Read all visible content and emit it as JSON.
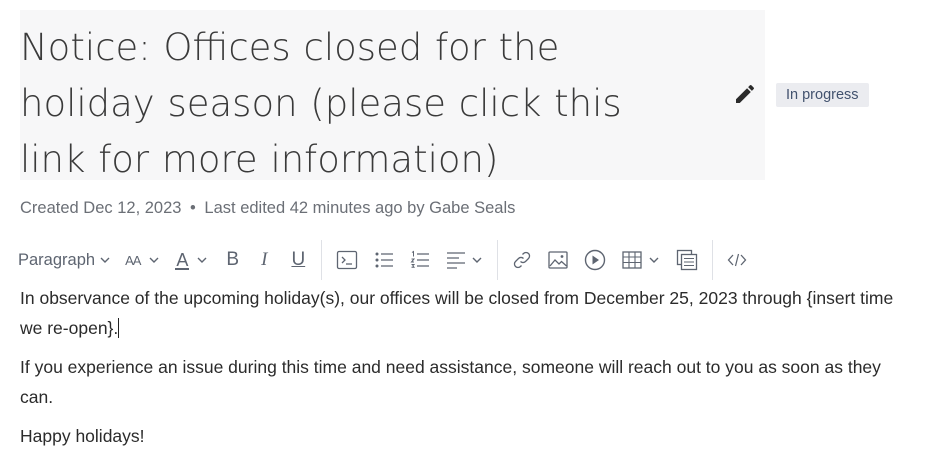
{
  "page": {
    "title": "Notice: Offices closed for the holiday season (please click this link for more information)",
    "status": "In progress",
    "meta": {
      "created": "Created Dec 12, 2023",
      "separator": "•",
      "edited": "Last edited 42 minutes ago by Gabe Seals"
    }
  },
  "toolbar": {
    "paragraph_label": "Paragraph",
    "text_size_label": "AA",
    "text_color_label": "A",
    "bold_label": "B",
    "italic_label": "I",
    "underline_label": "U",
    "icons": [
      "code-snippet-icon",
      "bullet-list-icon",
      "numbered-list-icon",
      "align-icon",
      "link-icon",
      "image-icon",
      "media-icon",
      "table-icon",
      "layouts-icon",
      "code-view-icon"
    ]
  },
  "body": {
    "paragraph1": "In observance of the upcoming holiday(s), our offices will be closed from December 25, 2023 through {insert time we re-open}.",
    "paragraph2": "If you experience an issue during this time and need assistance, someone will reach out to you as soon as they can.",
    "paragraph3": "Happy holidays!"
  },
  "colors": {
    "title_bg": "#f7f7f8",
    "badge_bg": "#ebecf0",
    "badge_text": "#42526e",
    "meta_text": "#6b6f76",
    "toolbar_icon": "#5e6571"
  }
}
